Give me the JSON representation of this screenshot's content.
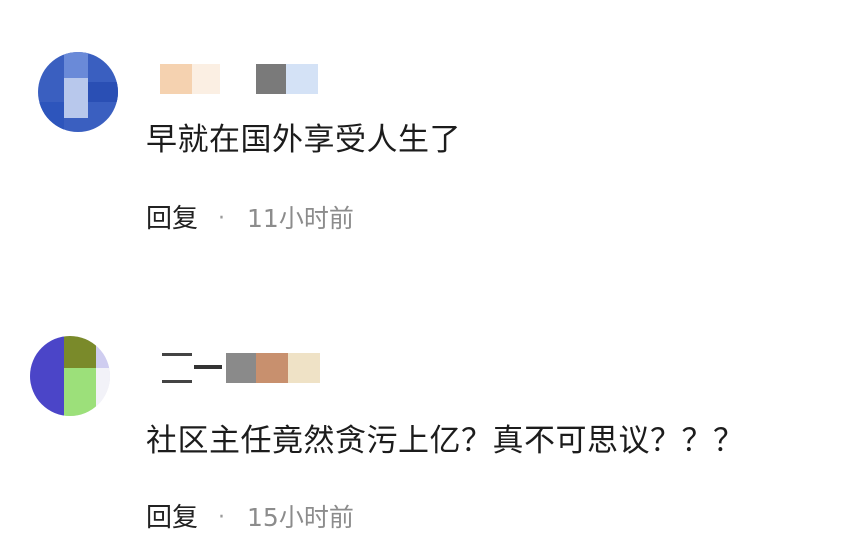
{
  "comments": [
    {
      "text": "早就在国外享受人生了",
      "reply_label": "回复",
      "separator": "·",
      "time": "11小时前",
      "colors": {
        "avatar_bg": "#3a5fc0",
        "name_a": "#f5d2b0",
        "name_b": "#7a7a7a",
        "name_c": "#d4e2f6"
      }
    },
    {
      "text": "社区主任竟然贪污上亿？真不可思议？？？",
      "reply_label": "回复",
      "separator": "·",
      "time": "15小时前",
      "colors": {
        "avatar_a": "#4b45c8",
        "avatar_b": "#7a8a2a",
        "avatar_c": "#9ce07a",
        "name_a": "#8a8a8a",
        "name_b": "#c8906e",
        "name_c": "#efe2c6"
      }
    }
  ]
}
